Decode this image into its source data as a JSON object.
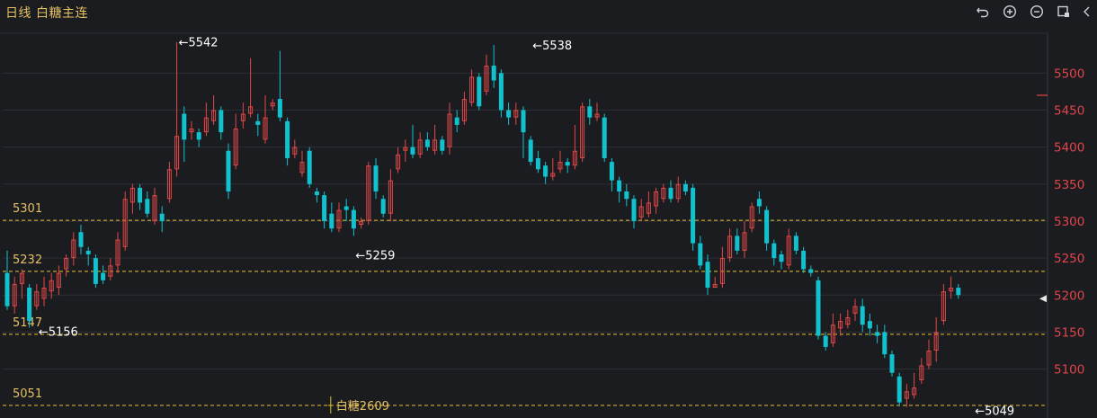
{
  "header": {
    "title": "日线 白糖主连",
    "tools": [
      {
        "name": "undo-icon"
      },
      {
        "name": "zoom-in-icon"
      },
      {
        "name": "zoom-out-icon"
      },
      {
        "name": "layout-settings-icon"
      },
      {
        "name": "collapse-icon"
      }
    ]
  },
  "colors": {
    "up": "#e04848",
    "down": "#11c1ce",
    "grid": "#2c2e35",
    "axis_text": "#e0454a",
    "level_line": "#e6c12b",
    "level_text": "#e6c163",
    "annotation": "#ffffff",
    "background": "#1b1c20"
  },
  "chart_data": {
    "type": "candlestick",
    "ylim": [
      5040,
      5560
    ],
    "yticks": [
      5100,
      5150,
      5200,
      5250,
      5300,
      5350,
      5400,
      5450,
      5500
    ],
    "current_price_marker": 5470,
    "horizontal_levels": [
      {
        "label": "5301",
        "value": 5301
      },
      {
        "label": "5232",
        "value": 5232
      },
      {
        "label": "5147",
        "value": 5147
      },
      {
        "label": "5051",
        "value": 5051
      }
    ],
    "annotations": [
      {
        "label": "←5542",
        "index": 23,
        "value": 5542
      },
      {
        "label": "←5538",
        "index": 71,
        "value": 5538
      },
      {
        "label": "←5259",
        "index": 47,
        "value": 5259
      },
      {
        "label": "←5156",
        "index": 4,
        "value": 5156
      },
      {
        "label": "←5049",
        "index": 131,
        "value": 5049
      }
    ],
    "contract_marker": {
      "label": "白糖2609",
      "index": 44
    },
    "candles": [
      [
        5230,
        5185,
        5260,
        5180
      ],
      [
        5185,
        5215,
        5225,
        5175
      ],
      [
        5215,
        5230,
        5235,
        5195
      ],
      [
        5210,
        5165,
        5215,
        5156
      ],
      [
        5185,
        5205,
        5215,
        5180
      ],
      [
        5195,
        5210,
        5225,
        5185
      ],
      [
        5205,
        5220,
        5230,
        5195
      ],
      [
        5210,
        5230,
        5240,
        5200
      ],
      [
        5235,
        5250,
        5255,
        5225
      ],
      [
        5250,
        5275,
        5285,
        5240
      ],
      [
        5285,
        5265,
        5295,
        5255
      ],
      [
        5260,
        5255,
        5265,
        5240
      ],
      [
        5250,
        5215,
        5255,
        5210
      ],
      [
        5230,
        5220,
        5240,
        5215
      ],
      [
        5225,
        5240,
        5250,
        5220
      ],
      [
        5240,
        5275,
        5285,
        5230
      ],
      [
        5265,
        5330,
        5340,
        5260
      ],
      [
        5325,
        5345,
        5350,
        5310
      ],
      [
        5345,
        5325,
        5350,
        5315
      ],
      [
        5330,
        5310,
        5340,
        5305
      ],
      [
        5300,
        5335,
        5345,
        5295
      ],
      [
        5310,
        5300,
        5320,
        5285
      ],
      [
        5330,
        5370,
        5380,
        5325
      ],
      [
        5370,
        5415,
        5542,
        5360
      ],
      [
        5445,
        5410,
        5455,
        5380
      ],
      [
        5420,
        5425,
        5435,
        5410
      ],
      [
        5420,
        5410,
        5425,
        5400
      ],
      [
        5420,
        5440,
        5460,
        5415
      ],
      [
        5435,
        5450,
        5470,
        5430
      ],
      [
        5450,
        5420,
        5455,
        5410
      ],
      [
        5395,
        5340,
        5405,
        5330
      ],
      [
        5375,
        5425,
        5445,
        5370
      ],
      [
        5435,
        5445,
        5460,
        5425
      ],
      [
        5445,
        5455,
        5520,
        5440
      ],
      [
        5435,
        5430,
        5445,
        5415
      ],
      [
        5410,
        5440,
        5470,
        5405
      ],
      [
        5455,
        5460,
        5465,
        5450
      ],
      [
        5465,
        5440,
        5530,
        5435
      ],
      [
        5435,
        5385,
        5440,
        5375
      ],
      [
        5390,
        5400,
        5410,
        5385
      ],
      [
        5365,
        5380,
        5395,
        5360
      ],
      [
        5395,
        5350,
        5400,
        5345
      ],
      [
        5340,
        5335,
        5345,
        5325
      ],
      [
        5335,
        5300,
        5340,
        5290
      ],
      [
        5310,
        5290,
        5325,
        5285
      ],
      [
        5290,
        5315,
        5325,
        5285
      ],
      [
        5320,
        5315,
        5330,
        5300
      ],
      [
        5315,
        5290,
        5320,
        5280
      ],
      [
        5295,
        5300,
        5305,
        5290
      ],
      [
        5300,
        5375,
        5380,
        5295
      ],
      [
        5375,
        5340,
        5385,
        5330
      ],
      [
        5330,
        5310,
        5335,
        5305
      ],
      [
        5310,
        5355,
        5370,
        5300
      ],
      [
        5370,
        5390,
        5400,
        5365
      ],
      [
        5395,
        5400,
        5410,
        5380
      ],
      [
        5400,
        5390,
        5430,
        5385
      ],
      [
        5390,
        5410,
        5420,
        5385
      ],
      [
        5410,
        5400,
        5420,
        5395
      ],
      [
        5395,
        5410,
        5430,
        5390
      ],
      [
        5410,
        5395,
        5415,
        5390
      ],
      [
        5400,
        5445,
        5460,
        5390
      ],
      [
        5440,
        5430,
        5450,
        5420
      ],
      [
        5435,
        5465,
        5475,
        5430
      ],
      [
        5460,
        5495,
        5505,
        5455
      ],
      [
        5495,
        5455,
        5500,
        5450
      ],
      [
        5475,
        5510,
        5525,
        5470
      ],
      [
        5510,
        5490,
        5538,
        5480
      ],
      [
        5500,
        5450,
        5505,
        5440
      ],
      [
        5450,
        5440,
        5460,
        5430
      ],
      [
        5440,
        5450,
        5460,
        5430
      ],
      [
        5450,
        5420,
        5455,
        5385
      ],
      [
        5410,
        5380,
        5415,
        5375
      ],
      [
        5385,
        5370,
        5395,
        5365
      ],
      [
        5375,
        5360,
        5380,
        5350
      ],
      [
        5360,
        5365,
        5385,
        5355
      ],
      [
        5370,
        5380,
        5395,
        5365
      ],
      [
        5380,
        5375,
        5385,
        5365
      ],
      [
        5375,
        5395,
        5430,
        5370
      ],
      [
        5385,
        5455,
        5460,
        5380
      ],
      [
        5455,
        5440,
        5465,
        5430
      ],
      [
        5440,
        5445,
        5460,
        5435
      ],
      [
        5440,
        5385,
        5445,
        5380
      ],
      [
        5380,
        5355,
        5385,
        5340
      ],
      [
        5355,
        5340,
        5360,
        5325
      ],
      [
        5340,
        5330,
        5350,
        5320
      ],
      [
        5330,
        5300,
        5335,
        5290
      ],
      [
        5305,
        5320,
        5330,
        5300
      ],
      [
        5310,
        5325,
        5340,
        5305
      ],
      [
        5320,
        5340,
        5345,
        5310
      ],
      [
        5330,
        5345,
        5350,
        5325
      ],
      [
        5345,
        5330,
        5355,
        5325
      ],
      [
        5330,
        5350,
        5360,
        5325
      ],
      [
        5350,
        5340,
        5355,
        5335
      ],
      [
        5345,
        5270,
        5350,
        5260
      ],
      [
        5270,
        5240,
        5280,
        5235
      ],
      [
        5245,
        5210,
        5255,
        5200
      ],
      [
        5210,
        5215,
        5225,
        5210
      ],
      [
        5215,
        5250,
        5265,
        5210
      ],
      [
        5250,
        5280,
        5290,
        5245
      ],
      [
        5280,
        5260,
        5290,
        5255
      ],
      [
        5260,
        5285,
        5300,
        5250
      ],
      [
        5290,
        5320,
        5325,
        5285
      ],
      [
        5330,
        5320,
        5340,
        5310
      ],
      [
        5315,
        5270,
        5320,
        5260
      ],
      [
        5270,
        5250,
        5275,
        5240
      ],
      [
        5255,
        5245,
        5260,
        5235
      ],
      [
        5240,
        5280,
        5290,
        5235
      ],
      [
        5280,
        5260,
        5285,
        5255
      ],
      [
        5260,
        5235,
        5265,
        5230
      ],
      [
        5235,
        5230,
        5240,
        5225
      ],
      [
        5220,
        5145,
        5225,
        5140
      ],
      [
        5145,
        5130,
        5150,
        5125
      ],
      [
        5135,
        5160,
        5175,
        5130
      ],
      [
        5155,
        5165,
        5175,
        5145
      ],
      [
        5160,
        5170,
        5180,
        5155
      ],
      [
        5175,
        5185,
        5195,
        5165
      ],
      [
        5185,
        5160,
        5195,
        5150
      ],
      [
        5165,
        5155,
        5175,
        5145
      ],
      [
        5150,
        5145,
        5160,
        5135
      ],
      [
        5150,
        5120,
        5160,
        5115
      ],
      [
        5120,
        5095,
        5125,
        5090
      ],
      [
        5090,
        5055,
        5095,
        5050
      ],
      [
        5060,
        5070,
        5080,
        5049
      ],
      [
        5065,
        5075,
        5095,
        5060
      ],
      [
        5085,
        5105,
        5115,
        5080
      ],
      [
        5105,
        5125,
        5140,
        5100
      ],
      [
        5125,
        5150,
        5170,
        5110
      ],
      [
        5165,
        5205,
        5215,
        5160
      ],
      [
        5205,
        5210,
        5225,
        5195
      ],
      [
        5210,
        5200,
        5215,
        5195
      ]
    ]
  }
}
